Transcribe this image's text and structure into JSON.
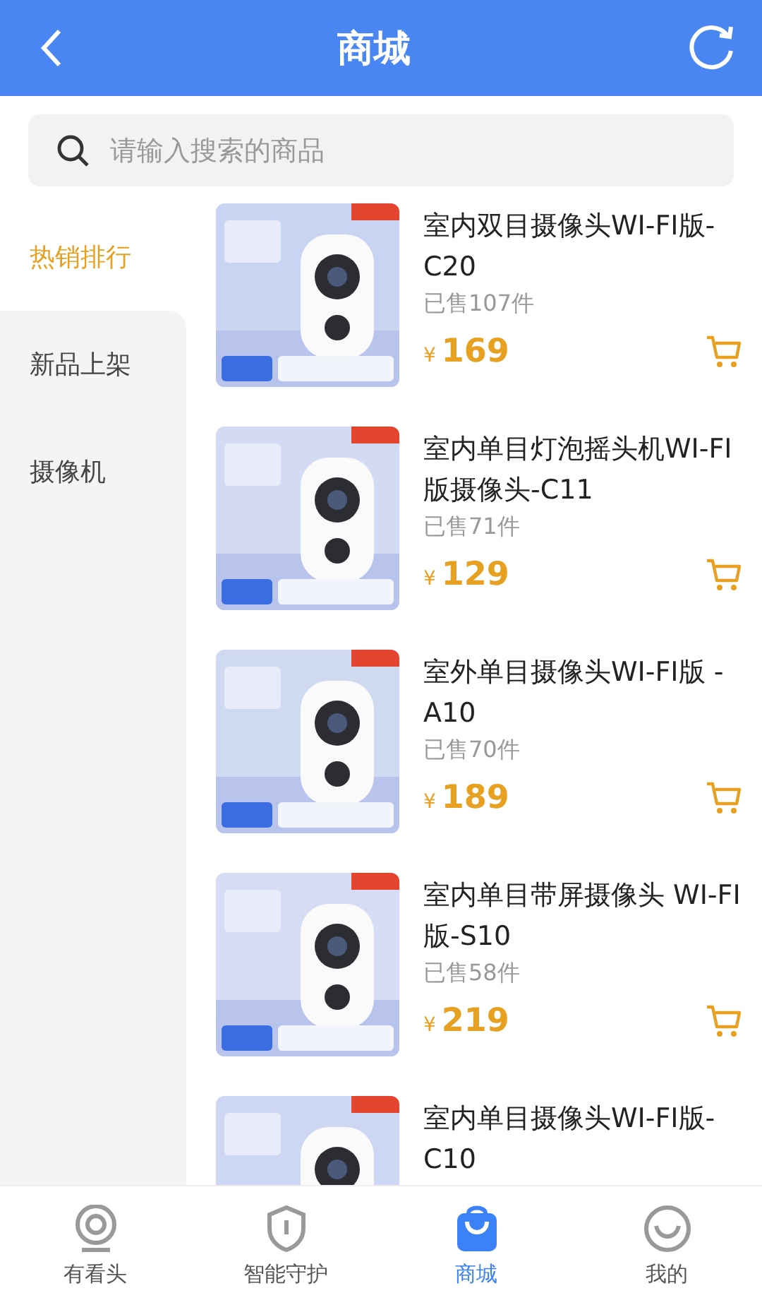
{
  "header": {
    "title": "商城"
  },
  "search": {
    "placeholder": "请输入搜索的商品"
  },
  "categories": [
    {
      "label": "热销排行",
      "selected": true
    },
    {
      "label": "新品上架",
      "selected": false
    },
    {
      "label": "摄像机",
      "selected": false
    }
  ],
  "products": [
    {
      "title": "室内双目摄像头WI-FI版-C20",
      "sold": "已售107件",
      "currency": "¥",
      "price": "169"
    },
    {
      "title": "室内单目灯泡摇头机WI-FI版摄像头-C11",
      "sold": "已售71件",
      "currency": "¥",
      "price": "129"
    },
    {
      "title": "室外单目摄像头WI-FI版 -A10",
      "sold": "已售70件",
      "currency": "¥",
      "price": "189"
    },
    {
      "title": "室内单目带屏摄像头 WI-FI版-S10",
      "sold": "已售58件",
      "currency": "¥",
      "price": "219"
    },
    {
      "title": "室内单目摄像头WI-FI版-C10"
    }
  ],
  "tabbar": [
    {
      "label": "有看头",
      "kind": "camera",
      "selected": false
    },
    {
      "label": "智能守护",
      "kind": "shield",
      "selected": false
    },
    {
      "label": "商城",
      "kind": "bag",
      "selected": true
    },
    {
      "label": "我的",
      "kind": "smile",
      "selected": false
    }
  ]
}
